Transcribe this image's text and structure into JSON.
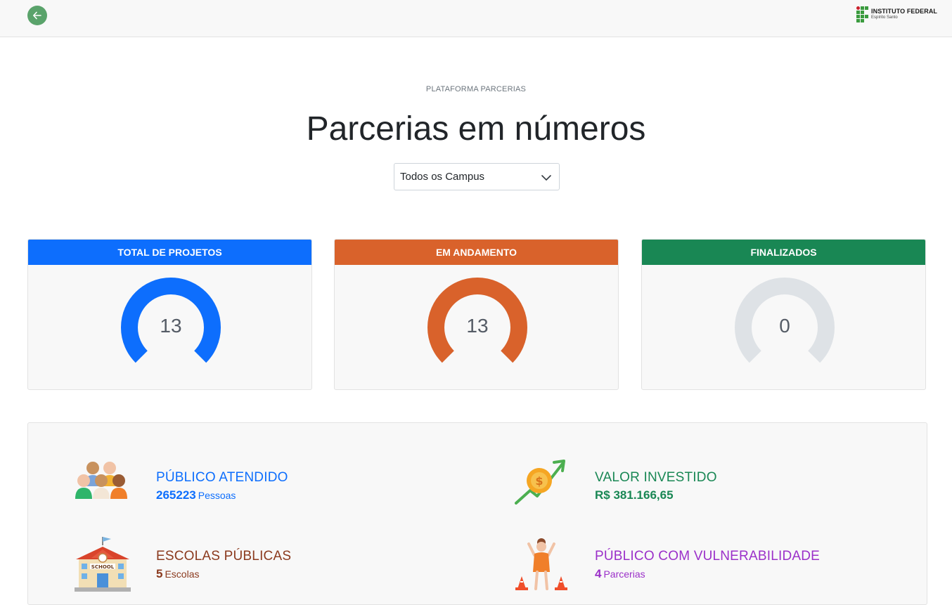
{
  "header": {
    "logo_title": "INSTITUTO FEDERAL",
    "logo_subtitle": "Espírito Santo"
  },
  "page": {
    "eyebrow": "PLATAFORMA PARCERIAS",
    "title": "Parcerias em números"
  },
  "filter": {
    "selected": "Todos os Campus"
  },
  "cards": [
    {
      "title": "TOTAL DE PROJETOS",
      "value": "13",
      "color": "#0d6efd",
      "fill": 1
    },
    {
      "title": "EM ANDAMENTO",
      "value": "13",
      "color": "#d9622b",
      "fill": 1
    },
    {
      "title": "FINALIZADOS",
      "value": "0",
      "color": "#198754",
      "fill": 0
    }
  ],
  "gauge_track_color": "#dee2e6",
  "stats": [
    {
      "label": "PÚBLICO ATENDIDO",
      "value": "265223",
      "unit": "Pessoas",
      "color": "#0d6efd",
      "icon": "people-group-icon"
    },
    {
      "label": "VALOR INVESTIDO",
      "value": "R$ 381.166,65",
      "unit": "",
      "color": "#198754",
      "icon": "money-growth-icon"
    },
    {
      "label": "ESCOLAS PÚBLICAS",
      "value": "5",
      "unit": "Escolas",
      "color": "#8b3a1e",
      "icon": "school-icon"
    },
    {
      "label": "PÚBLICO COM VULNERABILIDADE",
      "value": "4",
      "unit": "Parcerias",
      "color": "#9b30c9",
      "icon": "person-cones-icon"
    }
  ]
}
